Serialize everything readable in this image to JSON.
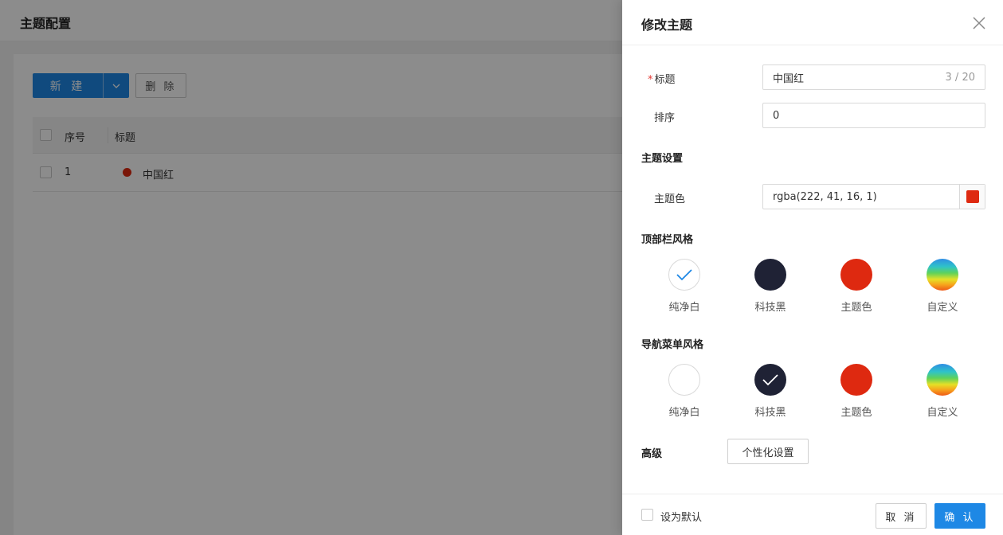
{
  "page": {
    "title": "主题配置",
    "toolbar": {
      "new_label": "新 建",
      "delete_label": "删 除"
    },
    "table": {
      "columns": [
        "序号",
        "标题"
      ],
      "rows": [
        {
          "index": "1",
          "title": "中国红",
          "color": "#de2910"
        }
      ]
    }
  },
  "drawer": {
    "title": "修改主题",
    "form": {
      "title_label": "标题",
      "title_value": "中国红",
      "title_count": "3 / 20",
      "order_label": "排序",
      "order_value": "0",
      "theme_settings_heading": "主题设置",
      "theme_color_label": "主题色",
      "theme_color_value": "rgba(222, 41, 16, 1)",
      "theme_color_hex": "#de2910",
      "topbar_heading": "顶部栏风格",
      "topbar_options": [
        {
          "label": "纯净白",
          "selected": true
        },
        {
          "label": "科技黑",
          "selected": false
        },
        {
          "label": "主题色",
          "selected": false
        },
        {
          "label": "自定义",
          "selected": false
        }
      ],
      "nav_heading": "导航菜单风格",
      "nav_options": [
        {
          "label": "纯净白",
          "selected": false
        },
        {
          "label": "科技黑",
          "selected": true
        },
        {
          "label": "主题色",
          "selected": false
        },
        {
          "label": "自定义",
          "selected": false
        }
      ],
      "advanced_label": "高级",
      "personalize_button": "个性化设置"
    },
    "footer": {
      "default_checkbox_label": "设为默认",
      "cancel_label": "取 消",
      "confirm_label": "确 认"
    }
  }
}
